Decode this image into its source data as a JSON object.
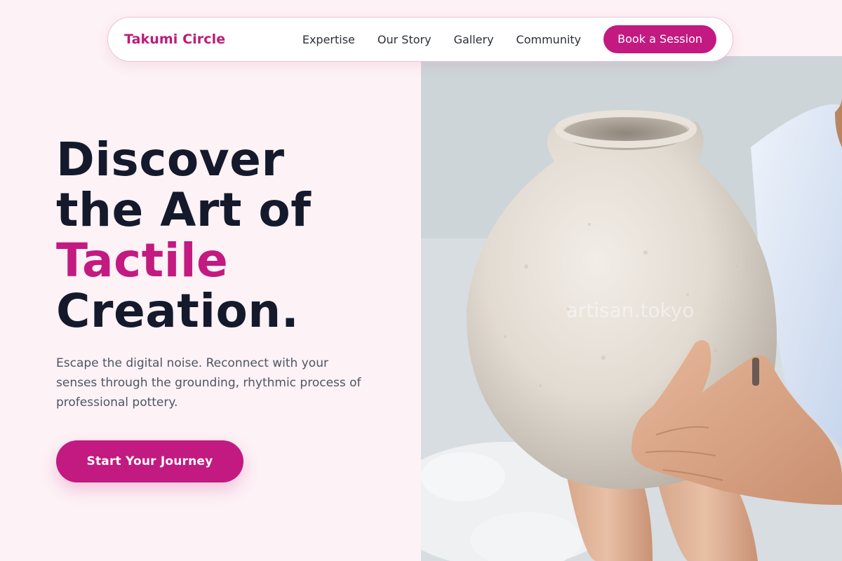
{
  "brand": {
    "name": "Takumi Circle"
  },
  "nav": {
    "links": [
      "Expertise",
      "Our Story",
      "Gallery",
      "Community"
    ],
    "cta_label": "Book a Session"
  },
  "hero": {
    "headline": {
      "line1": "Discover",
      "line2": "the Art of",
      "accent": "Tactile",
      "line4": "Creation."
    },
    "subtext": "Escape the digital noise. Reconnect with your senses through the grounding, rhythmic process of professional pottery.",
    "cta_label": "Start Your Journey",
    "image": {
      "subject": "hands holding a large textured unglazed clay vase",
      "watermark": "artisan.tokyo"
    }
  },
  "colors": {
    "accent": "#c21a80",
    "background": "#fdf2f6",
    "heading": "#141a2b",
    "body_text": "#4e5563"
  }
}
